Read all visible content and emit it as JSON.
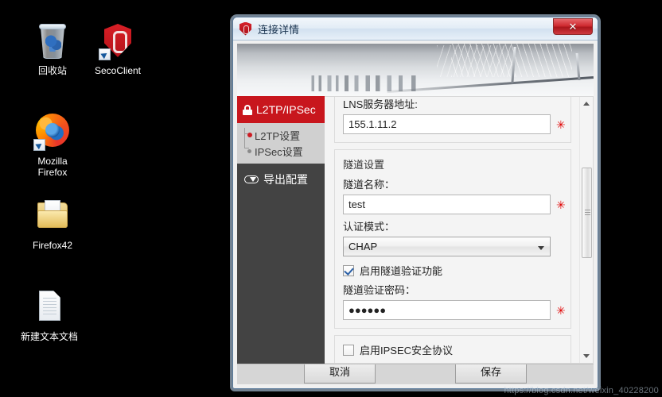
{
  "desktop": {
    "icons": [
      {
        "name": "recycle-bin",
        "label": "回收站"
      },
      {
        "name": "secoclient",
        "label": "SecoClient"
      },
      {
        "name": "mozilla-firefox",
        "label": "Mozilla\nFirefox"
      },
      {
        "name": "firefox42-folder",
        "label": "Firefox42"
      },
      {
        "name": "new-text-document",
        "label": "新建文本文档"
      }
    ]
  },
  "dialog": {
    "title": "连接详情",
    "close_label": "✕",
    "sidebar": {
      "nav_head": "L2TP/IPSec",
      "tree": [
        {
          "label": "L2TP设置",
          "selected": true
        },
        {
          "label": "IPSec设置",
          "selected": false
        }
      ],
      "export_label": "导出配置"
    },
    "form": {
      "clipped_field_value": "",
      "lns_label": "LNS服务器地址:",
      "lns_value": "155.1.11.2",
      "tunnel_group_title": "隧道设置",
      "tunnel_name_label": "隧道名称：",
      "tunnel_name_value": "test",
      "auth_mode_label": "认证模式：",
      "auth_mode_value": "CHAP",
      "enable_tunnel_auth_label": "启用隧道验证功能",
      "enable_tunnel_auth_checked": true,
      "tunnel_password_label": "隧道验证密码：",
      "tunnel_password_value": "●●●●●●",
      "enable_ipsec_label": "启用IPSEC安全协议",
      "enable_ipsec_checked": false,
      "required_mark": "✳"
    },
    "footer": {
      "cancel_label": "取消",
      "save_label": "保存"
    }
  },
  "watermark": "https://blog.csdn.net/weixin_40228200",
  "colors": {
    "accent_red": "#c8161d",
    "titlebar_blue": "#d2e1f0",
    "sidebar_dark": "#434343",
    "tree_bg": "#d0d0d0",
    "required_red": "#e00000"
  }
}
